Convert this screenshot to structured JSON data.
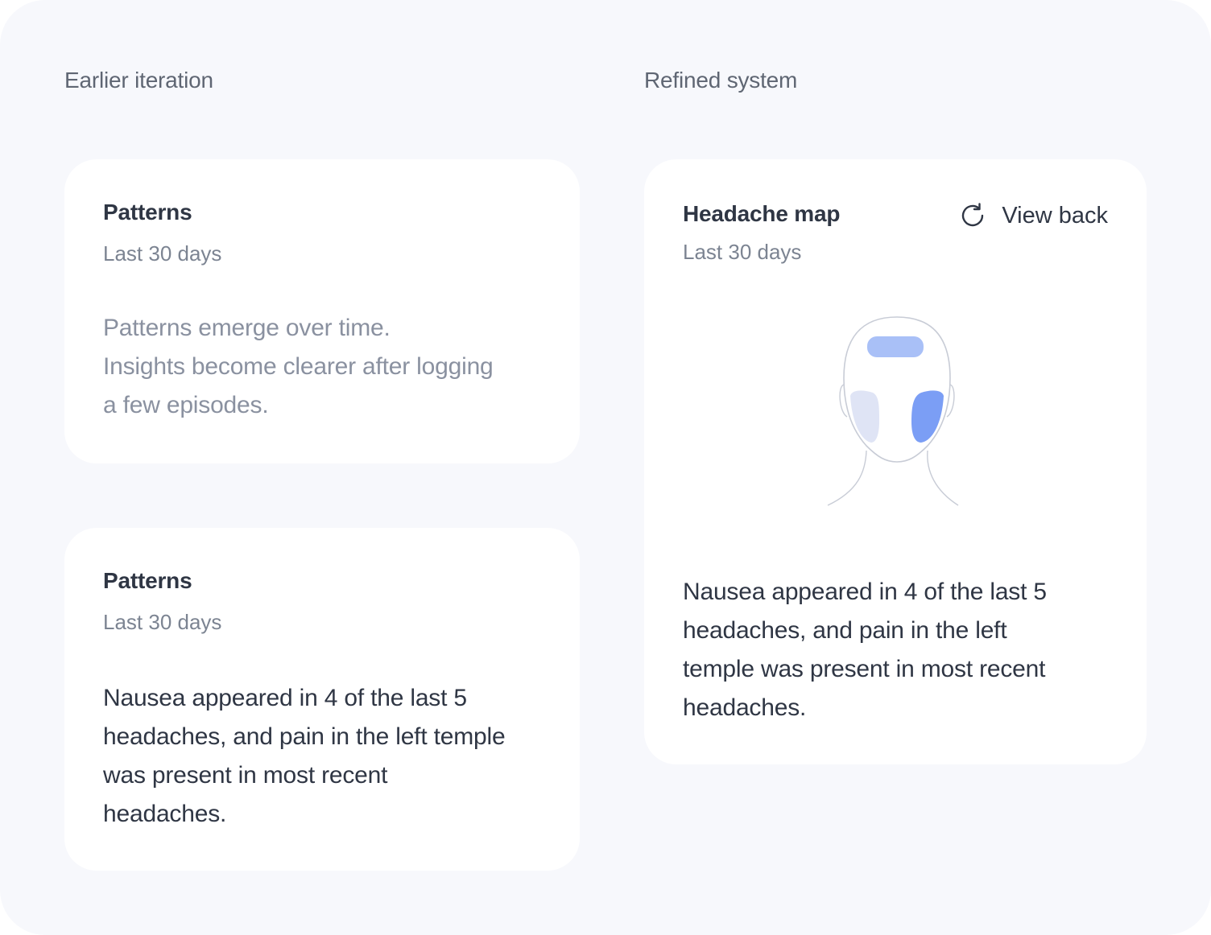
{
  "columns": {
    "left_heading": "Earlier iteration",
    "right_heading": "Refined system"
  },
  "empty_card": {
    "title": "Patterns",
    "subtitle": "Last 30 days",
    "body_lines": [
      "Patterns emerge over time.",
      "Insights become clearer after logging",
      "a few episodes."
    ]
  },
  "insight_card": {
    "title": "Patterns",
    "subtitle": "Last 30 days",
    "body_lines": [
      "Nausea appeared in 4 of the last 5",
      "headaches, and pain in the left temple",
      "was present in most recent",
      "headaches."
    ]
  },
  "map_card": {
    "title": "Headache map",
    "subtitle": "Last 30 days",
    "action_label": "View back",
    "action_icon": "refresh-icon",
    "body_lines": [
      "Nausea appeared in 4 of the last 5",
      "headaches, and pain in the left",
      "temple was present in most recent",
      "headaches."
    ],
    "head_regions": [
      {
        "region": "forehead",
        "color": "#a9c0f7"
      },
      {
        "region": "right-temple",
        "color": "#dfe4f5"
      },
      {
        "region": "left-temple",
        "color": "#7b9ef5"
      }
    ]
  }
}
